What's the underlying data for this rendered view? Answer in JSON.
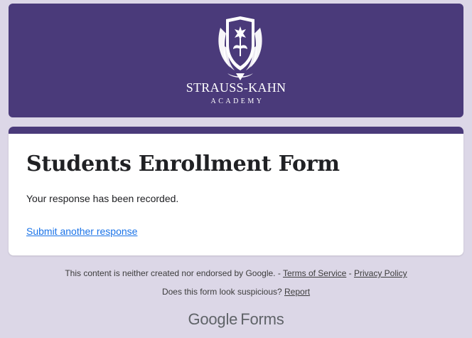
{
  "header": {
    "brand_name": "STRAUSS-KAHN",
    "brand_subtitle": "ACADEMY",
    "banner_color": "#4a3a7a",
    "logo_icon": "crest-shield-icon"
  },
  "form": {
    "title": "Students Enrollment Form",
    "confirmation_message": "Your response has been recorded.",
    "submit_another_label": "Submit another response"
  },
  "footer": {
    "disclaimer_text": "This content is neither created nor endorsed by Google. - ",
    "terms_label": "Terms of Service",
    "separator": " - ",
    "privacy_label": "Privacy Policy",
    "suspicious_text": "Does this form look suspicious? ",
    "report_label": "Report",
    "logo_google": "Google",
    "logo_forms": "Forms"
  },
  "colors": {
    "page_background": "#dcd7e7",
    "accent": "#4a3a7a",
    "link": "#1a73e8"
  }
}
